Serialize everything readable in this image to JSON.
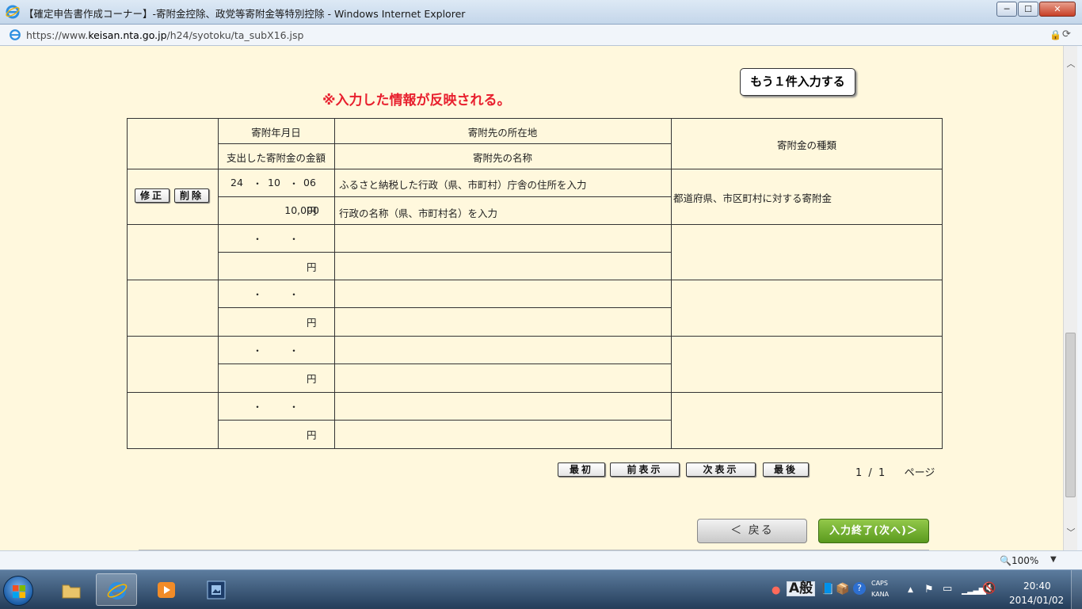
{
  "window": {
    "title": "【確定申告書作成コーナー】-寄附金控除、政党等寄附金等特別控除 - Windows Internet Explorer",
    "min_glyph": "─",
    "max_glyph": "☐",
    "close_glyph": "✕"
  },
  "address": {
    "url_prefix": "https://www.",
    "url_domain": "keisan.nta.go.jp",
    "url_path": "/h24/syotoku/ta_subX16.jsp"
  },
  "page": {
    "notice": "※入力した情報が反映される。",
    "add_one_label": "もう１件入力する",
    "table": {
      "headers": {
        "date": "寄附年月日",
        "amount": "支出した寄附金の金額",
        "address": "寄附先の所在地",
        "name": "寄附先の名称",
        "type": "寄附金の種類"
      },
      "rows": [
        {
          "edit_label": "修正",
          "delete_label": "削除",
          "year": "24",
          "month": "10",
          "day": "06",
          "amount": "10,000",
          "address": "ふるさと納税した行政（県、市町村）庁舎の住所を入力",
          "name": "行政の名称（県、市町村名）を入力",
          "type": "都道府県、市区町村に対する寄附金"
        }
      ],
      "date_sep": "・",
      "yen": "円"
    },
    "pager": {
      "first": "最初",
      "prev": "前表示",
      "next": "次表示",
      "last": "最後",
      "current": "1",
      "total": "1",
      "sep": "/",
      "page_word": "ページ"
    },
    "back_label": "＜ 戻る",
    "finish_label": "入力終了(次へ)＞"
  },
  "statusbar": {
    "zoom": "100%"
  },
  "taskbar": {
    "ime_mode": "A",
    "ime_label": "般",
    "caps": "CAPS",
    "kana": "KANA",
    "time": "20:40",
    "date": "2014/01/02"
  },
  "colors": {
    "page_bg": "#fff8dd",
    "notice_red": "#e8202e",
    "finish_green": "#5a9a1e"
  }
}
